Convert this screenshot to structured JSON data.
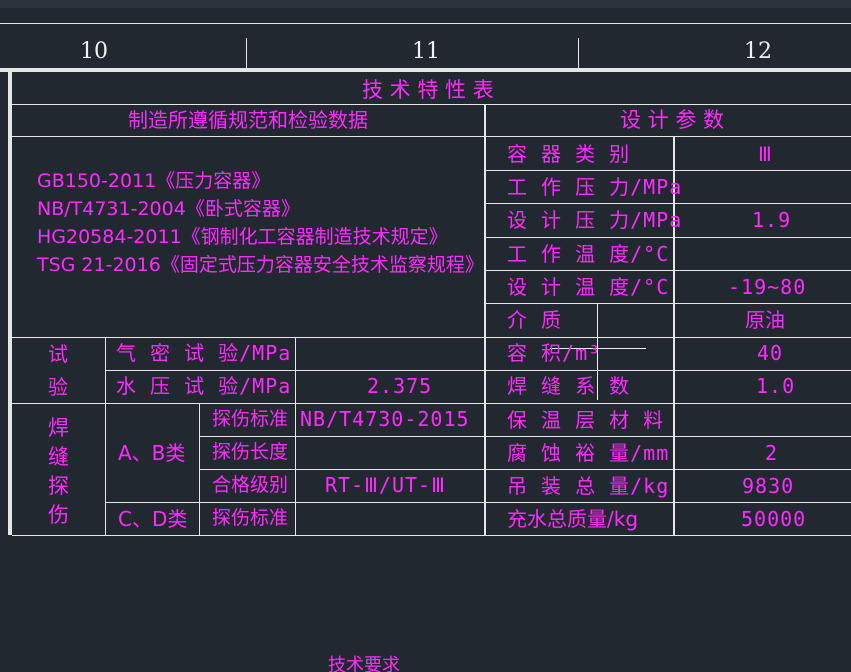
{
  "ruler": {
    "col1": "10",
    "col2": "11",
    "col3": "12"
  },
  "table": {
    "title": "技 术 特 性 表",
    "left_header": "制造所遵循规范和检验数据",
    "right_header": "设 计 参 数",
    "standards": [
      "GB150-2011《压力容器》",
      "NB/T4731-2004《卧式容器》",
      "HG20584-2011《钢制化工容器制造技术规定》",
      "TSG 21-2016《固定式压力容器安全技术监察规程》"
    ],
    "test": {
      "label_1": "试",
      "label_2": "验",
      "rows": [
        {
          "name": "气 密 试 验/MPa",
          "value": ""
        },
        {
          "name": "水 压 试 验/MPa",
          "value": "2.375"
        }
      ]
    },
    "ndt": {
      "label": [
        "焊",
        "缝",
        "探",
        "伤"
      ],
      "class_ab": "A、B类",
      "class_cd": "C、D类",
      "rows": [
        {
          "name": "探伤标准",
          "value": "NB/T4730-2015"
        },
        {
          "name": "探伤长度",
          "value": ""
        },
        {
          "name": "合格级别",
          "value": "RT-Ⅲ/UT-Ⅲ"
        },
        {
          "name": "探伤标准",
          "value": ""
        }
      ]
    },
    "params": [
      {
        "name": "容 器 类 别",
        "value": "Ⅲ"
      },
      {
        "name": "工 作 压 力/MPa",
        "value": ""
      },
      {
        "name": "设 计 压 力/MPa",
        "value": "1.9"
      },
      {
        "name": "工 作 温 度/°C",
        "value": ""
      },
      {
        "name": "设 计 温 度/°C",
        "value": "-19~80"
      },
      {
        "name": "介 质",
        "value": "原油"
      },
      {
        "name": "容 积/m³",
        "value": "40"
      },
      {
        "name": "焊 缝 系 数",
        "value": "1.0"
      },
      {
        "name": "保 温 层 材 料",
        "value": ""
      },
      {
        "name": "腐 蚀 裕 量/mm",
        "value": "2"
      },
      {
        "name": "吊 装 总 量/kg",
        "value": "9830"
      },
      {
        "name": "充水总质量/kg",
        "value": "50000"
      }
    ]
  },
  "bottom_text": "技术要求"
}
